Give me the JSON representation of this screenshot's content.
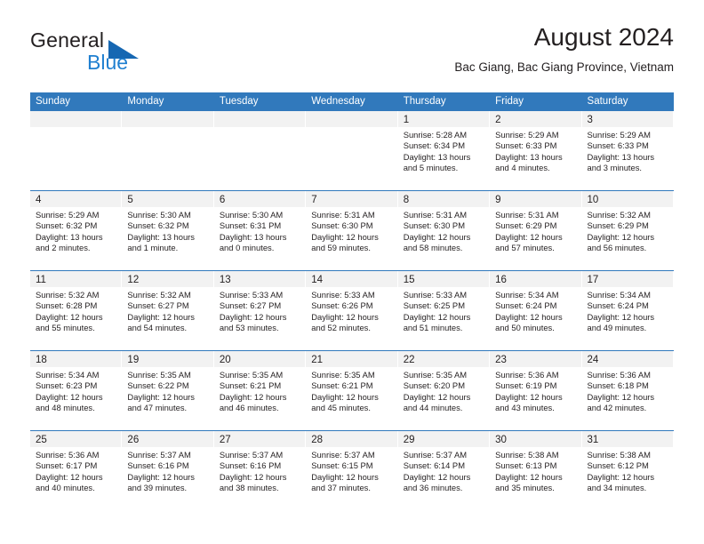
{
  "brand": {
    "name_top": "General",
    "name_bottom": "Blue",
    "triangle_color": "#1667b2",
    "blue_color": "#1f7fd0"
  },
  "header": {
    "title": "August 2024",
    "location": "Bac Giang, Bac Giang Province, Vietnam"
  },
  "calendar": {
    "accent_color": "#3179bc",
    "daynum_band_color": "#f2f2f2",
    "weekday_headers": [
      "Sunday",
      "Monday",
      "Tuesday",
      "Wednesday",
      "Thursday",
      "Friday",
      "Saturday"
    ],
    "weeks": [
      [
        {
          "day": "",
          "empty": true
        },
        {
          "day": "",
          "empty": true
        },
        {
          "day": "",
          "empty": true
        },
        {
          "day": "",
          "empty": true
        },
        {
          "day": "1",
          "sunrise": "Sunrise: 5:28 AM",
          "sunset": "Sunset: 6:34 PM",
          "daylight_1": "Daylight: 13 hours",
          "daylight_2": "and 5 minutes."
        },
        {
          "day": "2",
          "sunrise": "Sunrise: 5:29 AM",
          "sunset": "Sunset: 6:33 PM",
          "daylight_1": "Daylight: 13 hours",
          "daylight_2": "and 4 minutes."
        },
        {
          "day": "3",
          "sunrise": "Sunrise: 5:29 AM",
          "sunset": "Sunset: 6:33 PM",
          "daylight_1": "Daylight: 13 hours",
          "daylight_2": "and 3 minutes."
        }
      ],
      [
        {
          "day": "4",
          "sunrise": "Sunrise: 5:29 AM",
          "sunset": "Sunset: 6:32 PM",
          "daylight_1": "Daylight: 13 hours",
          "daylight_2": "and 2 minutes."
        },
        {
          "day": "5",
          "sunrise": "Sunrise: 5:30 AM",
          "sunset": "Sunset: 6:32 PM",
          "daylight_1": "Daylight: 13 hours",
          "daylight_2": "and 1 minute."
        },
        {
          "day": "6",
          "sunrise": "Sunrise: 5:30 AM",
          "sunset": "Sunset: 6:31 PM",
          "daylight_1": "Daylight: 13 hours",
          "daylight_2": "and 0 minutes."
        },
        {
          "day": "7",
          "sunrise": "Sunrise: 5:31 AM",
          "sunset": "Sunset: 6:30 PM",
          "daylight_1": "Daylight: 12 hours",
          "daylight_2": "and 59 minutes."
        },
        {
          "day": "8",
          "sunrise": "Sunrise: 5:31 AM",
          "sunset": "Sunset: 6:30 PM",
          "daylight_1": "Daylight: 12 hours",
          "daylight_2": "and 58 minutes."
        },
        {
          "day": "9",
          "sunrise": "Sunrise: 5:31 AM",
          "sunset": "Sunset: 6:29 PM",
          "daylight_1": "Daylight: 12 hours",
          "daylight_2": "and 57 minutes."
        },
        {
          "day": "10",
          "sunrise": "Sunrise: 5:32 AM",
          "sunset": "Sunset: 6:29 PM",
          "daylight_1": "Daylight: 12 hours",
          "daylight_2": "and 56 minutes."
        }
      ],
      [
        {
          "day": "11",
          "sunrise": "Sunrise: 5:32 AM",
          "sunset": "Sunset: 6:28 PM",
          "daylight_1": "Daylight: 12 hours",
          "daylight_2": "and 55 minutes."
        },
        {
          "day": "12",
          "sunrise": "Sunrise: 5:32 AM",
          "sunset": "Sunset: 6:27 PM",
          "daylight_1": "Daylight: 12 hours",
          "daylight_2": "and 54 minutes."
        },
        {
          "day": "13",
          "sunrise": "Sunrise: 5:33 AM",
          "sunset": "Sunset: 6:27 PM",
          "daylight_1": "Daylight: 12 hours",
          "daylight_2": "and 53 minutes."
        },
        {
          "day": "14",
          "sunrise": "Sunrise: 5:33 AM",
          "sunset": "Sunset: 6:26 PM",
          "daylight_1": "Daylight: 12 hours",
          "daylight_2": "and 52 minutes."
        },
        {
          "day": "15",
          "sunrise": "Sunrise: 5:33 AM",
          "sunset": "Sunset: 6:25 PM",
          "daylight_1": "Daylight: 12 hours",
          "daylight_2": "and 51 minutes."
        },
        {
          "day": "16",
          "sunrise": "Sunrise: 5:34 AM",
          "sunset": "Sunset: 6:24 PM",
          "daylight_1": "Daylight: 12 hours",
          "daylight_2": "and 50 minutes."
        },
        {
          "day": "17",
          "sunrise": "Sunrise: 5:34 AM",
          "sunset": "Sunset: 6:24 PM",
          "daylight_1": "Daylight: 12 hours",
          "daylight_2": "and 49 minutes."
        }
      ],
      [
        {
          "day": "18",
          "sunrise": "Sunrise: 5:34 AM",
          "sunset": "Sunset: 6:23 PM",
          "daylight_1": "Daylight: 12 hours",
          "daylight_2": "and 48 minutes."
        },
        {
          "day": "19",
          "sunrise": "Sunrise: 5:35 AM",
          "sunset": "Sunset: 6:22 PM",
          "daylight_1": "Daylight: 12 hours",
          "daylight_2": "and 47 minutes."
        },
        {
          "day": "20",
          "sunrise": "Sunrise: 5:35 AM",
          "sunset": "Sunset: 6:21 PM",
          "daylight_1": "Daylight: 12 hours",
          "daylight_2": "and 46 minutes."
        },
        {
          "day": "21",
          "sunrise": "Sunrise: 5:35 AM",
          "sunset": "Sunset: 6:21 PM",
          "daylight_1": "Daylight: 12 hours",
          "daylight_2": "and 45 minutes."
        },
        {
          "day": "22",
          "sunrise": "Sunrise: 5:35 AM",
          "sunset": "Sunset: 6:20 PM",
          "daylight_1": "Daylight: 12 hours",
          "daylight_2": "and 44 minutes."
        },
        {
          "day": "23",
          "sunrise": "Sunrise: 5:36 AM",
          "sunset": "Sunset: 6:19 PM",
          "daylight_1": "Daylight: 12 hours",
          "daylight_2": "and 43 minutes."
        },
        {
          "day": "24",
          "sunrise": "Sunrise: 5:36 AM",
          "sunset": "Sunset: 6:18 PM",
          "daylight_1": "Daylight: 12 hours",
          "daylight_2": "and 42 minutes."
        }
      ],
      [
        {
          "day": "25",
          "sunrise": "Sunrise: 5:36 AM",
          "sunset": "Sunset: 6:17 PM",
          "daylight_1": "Daylight: 12 hours",
          "daylight_2": "and 40 minutes."
        },
        {
          "day": "26",
          "sunrise": "Sunrise: 5:37 AM",
          "sunset": "Sunset: 6:16 PM",
          "daylight_1": "Daylight: 12 hours",
          "daylight_2": "and 39 minutes."
        },
        {
          "day": "27",
          "sunrise": "Sunrise: 5:37 AM",
          "sunset": "Sunset: 6:16 PM",
          "daylight_1": "Daylight: 12 hours",
          "daylight_2": "and 38 minutes."
        },
        {
          "day": "28",
          "sunrise": "Sunrise: 5:37 AM",
          "sunset": "Sunset: 6:15 PM",
          "daylight_1": "Daylight: 12 hours",
          "daylight_2": "and 37 minutes."
        },
        {
          "day": "29",
          "sunrise": "Sunrise: 5:37 AM",
          "sunset": "Sunset: 6:14 PM",
          "daylight_1": "Daylight: 12 hours",
          "daylight_2": "and 36 minutes."
        },
        {
          "day": "30",
          "sunrise": "Sunrise: 5:38 AM",
          "sunset": "Sunset: 6:13 PM",
          "daylight_1": "Daylight: 12 hours",
          "daylight_2": "and 35 minutes."
        },
        {
          "day": "31",
          "sunrise": "Sunrise: 5:38 AM",
          "sunset": "Sunset: 6:12 PM",
          "daylight_1": "Daylight: 12 hours",
          "daylight_2": "and 34 minutes."
        }
      ]
    ]
  }
}
